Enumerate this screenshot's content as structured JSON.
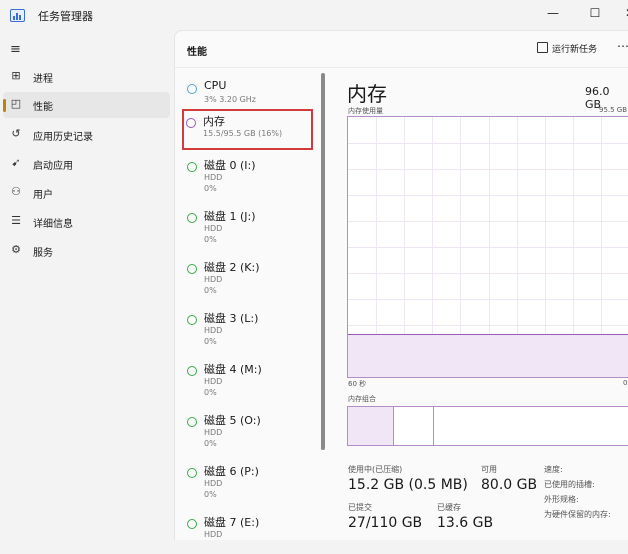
{
  "window": {
    "title": "任务管理器",
    "controls": {
      "minimize": "—",
      "maximize": "☐",
      "close": "✕"
    }
  },
  "nav": {
    "toggle": "≡",
    "items": [
      {
        "icon": "process-icon",
        "glyph": "⊞",
        "label": "进程"
      },
      {
        "icon": "performance-icon",
        "glyph": "◰",
        "label": "性能"
      },
      {
        "icon": "history-icon",
        "glyph": "↺",
        "label": "应用历史记录"
      },
      {
        "icon": "startup-icon",
        "glyph": "➹",
        "label": "启动应用"
      },
      {
        "icon": "users-icon",
        "glyph": "⚇",
        "label": "用户"
      },
      {
        "icon": "details-icon",
        "glyph": "☰",
        "label": "详细信息"
      },
      {
        "icon": "services-icon",
        "glyph": "⚙",
        "label": "服务"
      }
    ],
    "active_index": 1
  },
  "header": {
    "title": "性能",
    "run_task": "运行新任务",
    "more": "⋯"
  },
  "resources": [
    {
      "name": "CPU",
      "line1": "3% 3.20 GHz",
      "line2": "",
      "dot": "blue"
    },
    {
      "name": "内存",
      "line1": "15.5/95.5 GB (16%)",
      "line2": "",
      "dot": "purple"
    },
    {
      "name": "磁盘 0 (I:)",
      "line1": "HDD",
      "line2": "0%",
      "dot": "green"
    },
    {
      "name": "磁盘 1 (J:)",
      "line1": "HDD",
      "line2": "0%",
      "dot": "green"
    },
    {
      "name": "磁盘 2 (K:)",
      "line1": "HDD",
      "line2": "0%",
      "dot": "green"
    },
    {
      "name": "磁盘 3 (L:)",
      "line1": "HDD",
      "line2": "0%",
      "dot": "green"
    },
    {
      "name": "磁盘 4 (M:)",
      "line1": "HDD",
      "line2": "0%",
      "dot": "green"
    },
    {
      "name": "磁盘 5 (O:)",
      "line1": "HDD",
      "line2": "0%",
      "dot": "green"
    },
    {
      "name": "磁盘 6 (P:)",
      "line1": "HDD",
      "line2": "0%",
      "dot": "green"
    },
    {
      "name": "磁盘 7 (E:)",
      "line1": "HDD",
      "line2": "",
      "dot": "green"
    }
  ],
  "detail": {
    "title": "内存",
    "total": "96.0 GB",
    "graph_label": "内存使用量",
    "graph_max": "95.5 GB",
    "axis_left": "60 秒",
    "axis_right": "0",
    "usage_fraction": 0.16,
    "composition_label": "内存组合",
    "composition": {
      "in_use_fraction": 0.16,
      "modified_fraction": 0.14
    },
    "stats": {
      "in_use_label": "使用中(已压缩)",
      "in_use_value": "15.2 GB (0.5 MB)",
      "available_label": "可用",
      "available_value": "80.0 GB",
      "committed_label": "已提交",
      "committed_value": "27/110 GB",
      "cached_label": "已缓存",
      "cached_value": "13.6 GB",
      "speed_label": "速度:",
      "slots_label": "已使用的插槽:",
      "form_factor_label": "外形规格:",
      "hw_reserved_label": "为硬件保留的内存:"
    }
  },
  "colors": {
    "memory": "#9b59b6",
    "cpu": "#5aa3d6",
    "disk": "#3fa94c",
    "highlight": "#d23b3b",
    "nav_indicator": "#b8860b"
  }
}
